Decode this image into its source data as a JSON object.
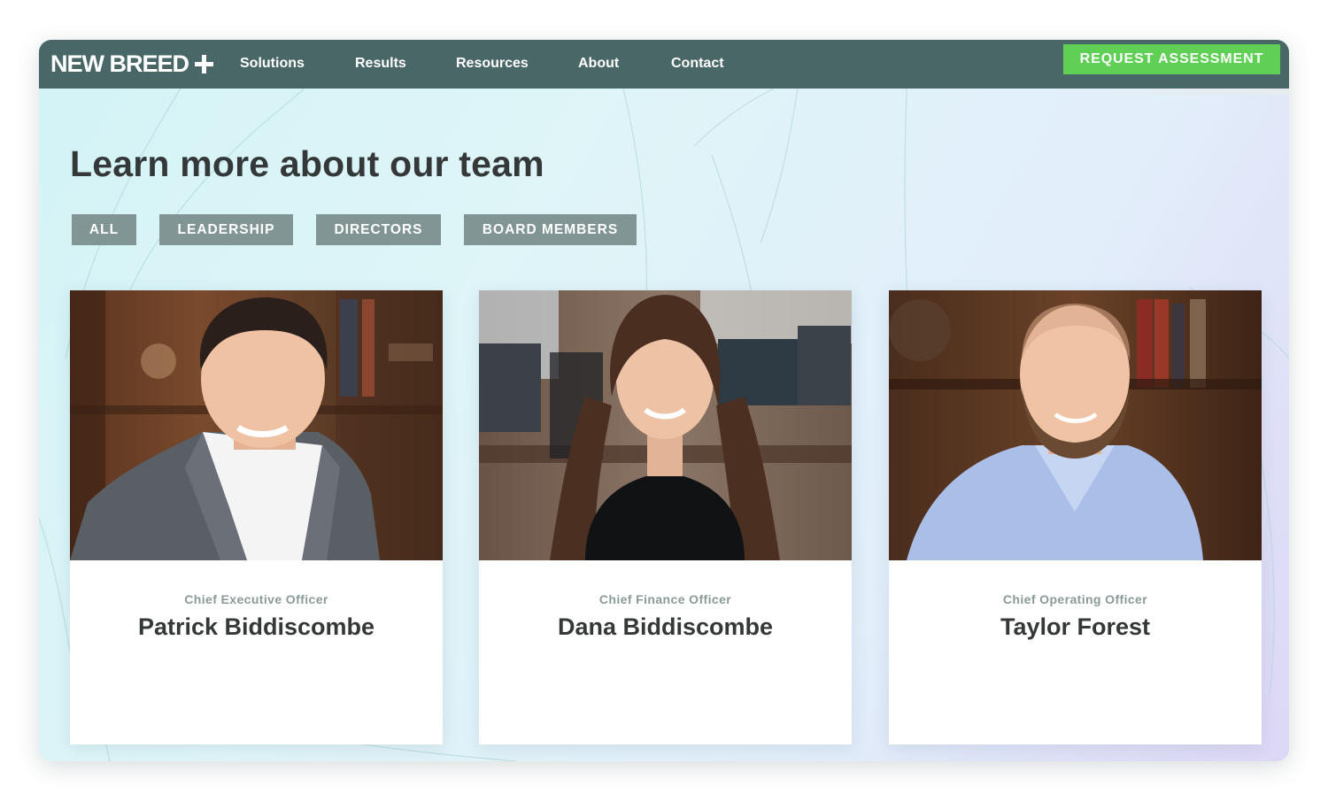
{
  "brand": {
    "name": "NEW BREED"
  },
  "nav": {
    "links": [
      "Solutions",
      "Results",
      "Resources",
      "About",
      "Contact"
    ],
    "cta_label": "REQUEST ASSESSMENT"
  },
  "page": {
    "title": "Learn more about our team"
  },
  "filters": [
    "ALL",
    "LEADERSHIP",
    "DIRECTORS",
    "BOARD MEMBERS"
  ],
  "team": [
    {
      "role": "Chief Executive Officer",
      "name": "Patrick Biddiscombe"
    },
    {
      "role": "Chief Finance Officer",
      "name": "Dana Biddiscombe"
    },
    {
      "role": "Chief Operating Officer",
      "name": "Taylor Forest"
    }
  ],
  "colors": {
    "nav_bg": "#4a6767",
    "cta": "#5fcf55",
    "filter_bg": "#829595",
    "heading": "#353838",
    "role_text": "#8a9a98"
  }
}
